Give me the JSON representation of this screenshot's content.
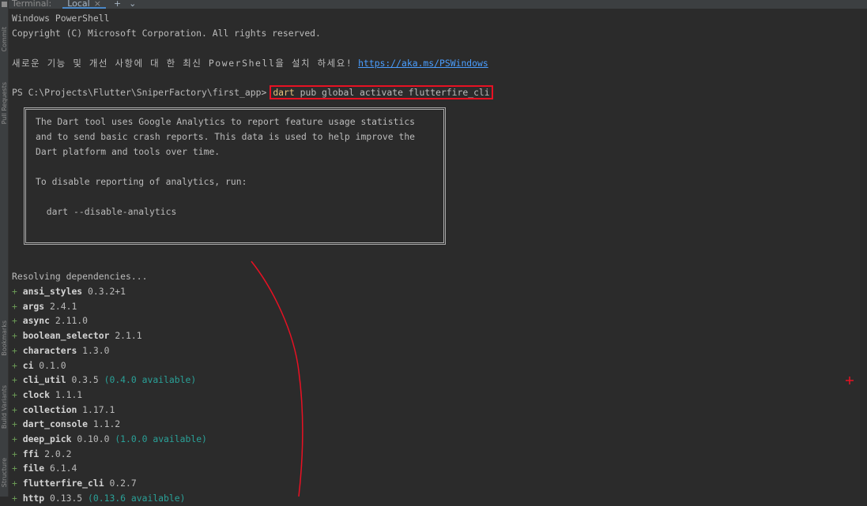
{
  "sidebar": {
    "tabs": [
      {
        "label": "Commit"
      },
      {
        "label": "Pull Requests"
      },
      {
        "label": "Bookmarks"
      },
      {
        "label": "Build Variants"
      },
      {
        "label": "Structure"
      }
    ]
  },
  "tabbar": {
    "title": "Terminal:",
    "active_tab": "Local",
    "close_glyph": "×",
    "add_glyph": "+",
    "more_glyph": "⌄"
  },
  "terminal": {
    "header": [
      "Windows PowerShell",
      "Copyright (C) Microsoft Corporation. All rights reserved."
    ],
    "update_notice": "새로운 기능 및 개선 사항에 대 한 최신 PowerShell을 설치 하세요!",
    "update_link": "https://aka.ms/PSWindows",
    "prompt": "PS C:\\Projects\\Flutter\\SniperFactory\\first_app>",
    "command_head": "dart",
    "command_rest": " pub global activate flutterfire_cli",
    "analytics_box": [
      "The Dart tool uses Google Analytics to report feature usage statistics",
      "and to send basic crash reports. This data is used to help improve the",
      "Dart platform and tools over time.",
      "",
      "To disable reporting of analytics, run:",
      "",
      "  dart --disable-analytics"
    ],
    "resolving": "Resolving dependencies...",
    "packages": [
      {
        "name": "ansi_styles",
        "version": "0.3.2+1",
        "note": ""
      },
      {
        "name": "args",
        "version": "2.4.1",
        "note": ""
      },
      {
        "name": "async",
        "version": "2.11.0",
        "note": ""
      },
      {
        "name": "boolean_selector",
        "version": "2.1.1",
        "note": ""
      },
      {
        "name": "characters",
        "version": "1.3.0",
        "note": ""
      },
      {
        "name": "ci",
        "version": "0.1.0",
        "note": ""
      },
      {
        "name": "cli_util",
        "version": "0.3.5",
        "note": "(0.4.0 available)"
      },
      {
        "name": "clock",
        "version": "1.1.1",
        "note": ""
      },
      {
        "name": "collection",
        "version": "1.17.1",
        "note": ""
      },
      {
        "name": "dart_console",
        "version": "1.1.2",
        "note": ""
      },
      {
        "name": "deep_pick",
        "version": "0.10.0",
        "note": "(1.0.0 available)"
      },
      {
        "name": "ffi",
        "version": "2.0.2",
        "note": ""
      },
      {
        "name": "file",
        "version": "6.1.4",
        "note": ""
      },
      {
        "name": "flutterfire_cli",
        "version": "0.2.7",
        "note": ""
      },
      {
        "name": "http",
        "version": "0.13.5",
        "note": "(0.13.6 available)"
      }
    ]
  },
  "colors": {
    "background": "#2b2b2b",
    "text": "#bbbbbb",
    "annotation": "#e81123",
    "link": "#4a9eff",
    "available": "#2aa198"
  }
}
